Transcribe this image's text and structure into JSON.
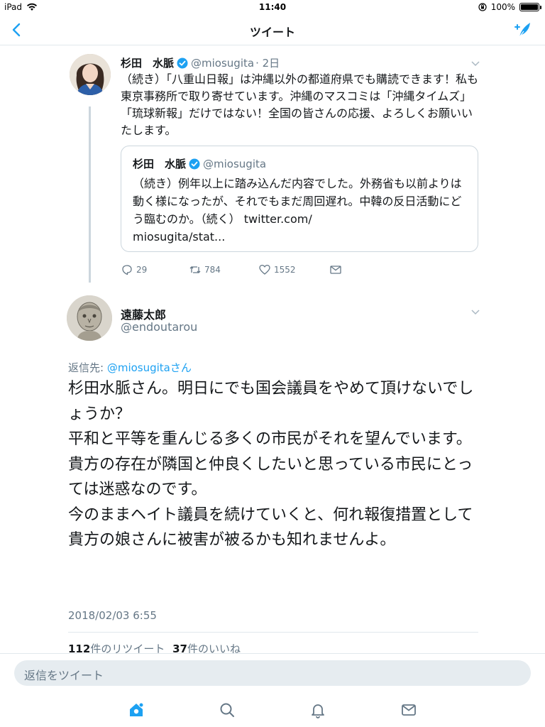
{
  "status_bar": {
    "device": "iPad",
    "time": "11:40",
    "battery": "100%"
  },
  "nav": {
    "title": "ツイート"
  },
  "quoted_thread_tweet": {
    "name": "杉田　水脈",
    "handle": "@miosugita",
    "age": "· 2日",
    "body": "（続き）「八重山日報」は沖縄以外の都道府県でも購読できます！私も東京事務所で取り寄せています。沖縄のマスコミは「沖縄タイムズ」「琉球新報」だけではない！全国の皆さんの応援、よろしくお願いいたします。",
    "quote": {
      "name": "杉田　水脈",
      "handle": "@miosugita",
      "body": "（続き）例年以上に踏み込んだ内容でした。外務省も以前よりは動く様になったが、それでもまだ周回遅れ。中韓の反日活動にどう臨むのか。（続く） twitter.com/\nmiosugita/stat..."
    },
    "actions": {
      "replies": "29",
      "retweets": "784",
      "likes": "1552"
    }
  },
  "main_tweet": {
    "name": "遠藤太郎",
    "handle": "@endoutarou",
    "reply_prefix": "返信先: ",
    "reply_target": "@miosugitaさん",
    "body": "杉田水脈さん。明日にでも国会議員をやめて頂けないでしょうか？\n平和と平等を重んじる多くの市民がそれを望んでいます。\n貴方の存在が隣国と仲良くしたいと思っている市民にとっては迷惑なのです。\n今のままヘイト議員を続けていくと、何れ報復措置として貴方の娘さんに被害が被るかも知れませんよ。",
    "timestamp": "2018/02/03 6:55",
    "retweet_count": "112",
    "retweet_label": "件のリツイート",
    "like_count": "37",
    "like_label": "件のいいね"
  },
  "reply_box": {
    "placeholder": "返信をツイート"
  },
  "colors": {
    "accent": "#1da1f2",
    "muted": "#657786",
    "text": "#14171a",
    "border": "#e1e8ed"
  },
  "icons": [
    "back-chevron-icon",
    "compose-icon",
    "verified-icon",
    "reply-icon",
    "retweet-icon",
    "like-icon",
    "dm-icon",
    "home-icon",
    "search-icon",
    "notifications-icon",
    "messages-icon"
  ]
}
